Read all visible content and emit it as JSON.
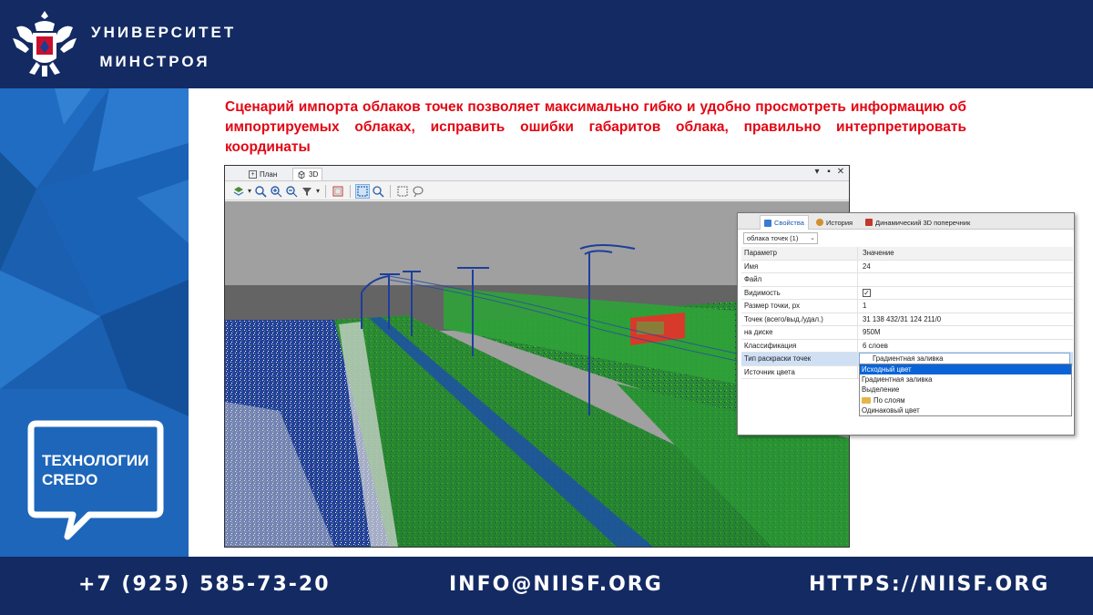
{
  "header": {
    "title_line1": "УНИВЕРСИТЕТ",
    "title_line2": "МИНСТРОЯ",
    "background_color": "#132a63"
  },
  "sidebar": {
    "logo_line1": "ТЕХНОЛОГИИ",
    "logo_line2": "CREDO",
    "background_color": "#1b5fb0"
  },
  "description": "Сценарий импорта облаков точек позволяет максимально гибко и удобно просмотреть информацию об импортируемых облаках, исправить ошибки габаритов облака, правильно интерпретировать координаты",
  "app": {
    "tabs": [
      {
        "label": "План",
        "icon": "plan-icon"
      },
      {
        "label": "3D",
        "icon": "cube-icon"
      }
    ],
    "toolbar_icons": [
      "layers-icon",
      "zoom-extent-icon",
      "zoom-in-icon",
      "zoom-out-icon",
      "filter-icon",
      "view-box-icon",
      "select-icon",
      "zoom-select-icon",
      "frame-icon",
      "lasso-icon"
    ]
  },
  "properties": {
    "tabs": [
      {
        "label": "Свойства",
        "icon": "properties-icon"
      },
      {
        "label": "История",
        "icon": "history-icon"
      },
      {
        "label": "Динамический 3D поперечник",
        "icon": "cross-section-icon"
      }
    ],
    "selector": "облака точек (1)",
    "header": {
      "param": "Параметр",
      "value": "Значение"
    },
    "rows": [
      {
        "param": "Имя",
        "value": "24"
      },
      {
        "param": "Файл",
        "value": ""
      },
      {
        "param": "Видимость",
        "value": "✓"
      },
      {
        "param": "Размер точки, px",
        "value": "1"
      },
      {
        "param": "Точек (всего/выд./удал.)",
        "value": "31 138 432/31 124 211/0"
      },
      {
        "param": "на диске",
        "value": "950M"
      },
      {
        "param": "Классификация",
        "value": "6 слоев"
      },
      {
        "param": "Тип раскраски точек",
        "value": "Градиентная заливка"
      },
      {
        "param": "Источник цвета",
        "value": ""
      }
    ],
    "dropdown_options": [
      "Исходный цвет",
      "Градиентная заливка",
      "Выделение",
      "По слоям",
      "Одинаковый цвет"
    ],
    "highlighted_option": "Исходный цвет"
  },
  "footer": {
    "phone": "+7 (925) 585-73-20",
    "email": "INFO@NIISF.ORG",
    "website": "HTTPS://NIISF.ORG"
  }
}
